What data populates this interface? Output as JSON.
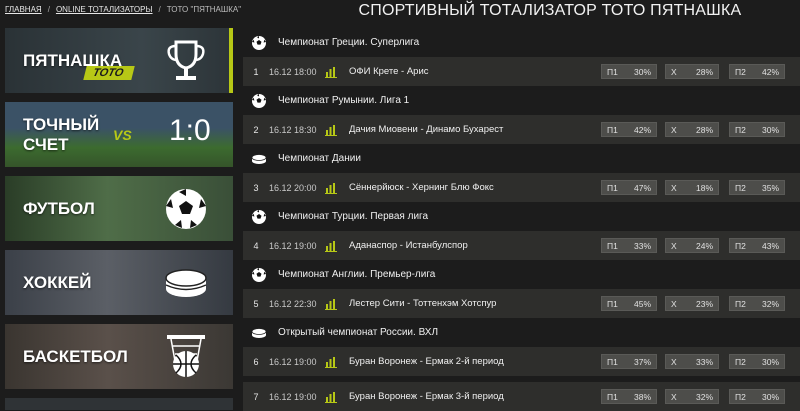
{
  "breadcrumb": {
    "home": "ГЛАВНАЯ",
    "section": "ONLINE ТОТАЛИЗАТОРЫ",
    "current": "ТОТО \"ПЯТНАШКА\""
  },
  "page_title": "СПОРТИВНЫЙ ТОТАЛИЗАТОР ТОТО ПЯТНАШКА",
  "sidebar": {
    "tiles": [
      {
        "label": "ПЯТНАШКА",
        "badge": "TOTO",
        "icon": "trophy-icon"
      },
      {
        "label": "ТОЧНЫЙ\nСЧЕТ",
        "vs": "VS",
        "score": "1:0"
      },
      {
        "label": "ФУТБОЛ",
        "icon": "soccer-ball-icon"
      },
      {
        "label": "ХОККЕЙ",
        "icon": "hockey-puck-icon"
      },
      {
        "label": "БАСКЕТБОЛ",
        "icon": "basketball-hoop-icon"
      }
    ]
  },
  "odds_labels": {
    "p1": "П1",
    "x": "Х",
    "p2": "П2"
  },
  "groups": [
    {
      "category": "Чемпионат Греции. Суперлига",
      "icon": "soccer-ball-icon",
      "match": {
        "num": "1",
        "time": "16.12 18:00",
        "teams": "ОФИ Крете - Арис",
        "p1": "30%",
        "x": "28%",
        "p2": "42%"
      }
    },
    {
      "category": "Чемпионат Румынии. Лига 1",
      "icon": "soccer-ball-icon",
      "match": {
        "num": "2",
        "time": "16.12 18:30",
        "teams": "Дачия Миовени - Динамо Бухарест",
        "p1": "42%",
        "x": "28%",
        "p2": "30%"
      }
    },
    {
      "category": "Чемпионат Дании",
      "icon": "hockey-puck-icon",
      "match": {
        "num": "3",
        "time": "16.12 20:00",
        "teams": "Сённерйюск - Хернинг Блю Фокс",
        "p1": "47%",
        "x": "18%",
        "p2": "35%"
      }
    },
    {
      "category": "Чемпионат Турции. Первая лига",
      "icon": "soccer-ball-icon",
      "match": {
        "num": "4",
        "time": "16.12 19:00",
        "teams": "Аданаспор - Истанбулспор",
        "p1": "33%",
        "x": "24%",
        "p2": "43%"
      }
    },
    {
      "category": "Чемпионат Англии. Премьер-лига",
      "icon": "soccer-ball-icon",
      "match": {
        "num": "5",
        "time": "16.12 22:30",
        "teams": "Лестер Сити - Тоттенхэм Хотспур",
        "p1": "45%",
        "x": "23%",
        "p2": "32%"
      }
    },
    {
      "category": "Открытый чемпионат России. ВХЛ",
      "icon": "hockey-puck-icon",
      "match": {
        "num": "6",
        "time": "16.12 19:00",
        "teams": "Буран Воронеж - Ермак 2-й период",
        "p1": "37%",
        "x": "33%",
        "p2": "30%"
      }
    }
  ],
  "extra_match": {
    "num": "7",
    "time": "16.12 19:00",
    "teams": "Буран Воронеж - Ермак 3-й период",
    "p1": "38%",
    "x": "32%",
    "p2": "30%"
  },
  "colors": {
    "accent": "#b7c816",
    "background": "#1c1c1c",
    "row": "#2e2e2c"
  }
}
